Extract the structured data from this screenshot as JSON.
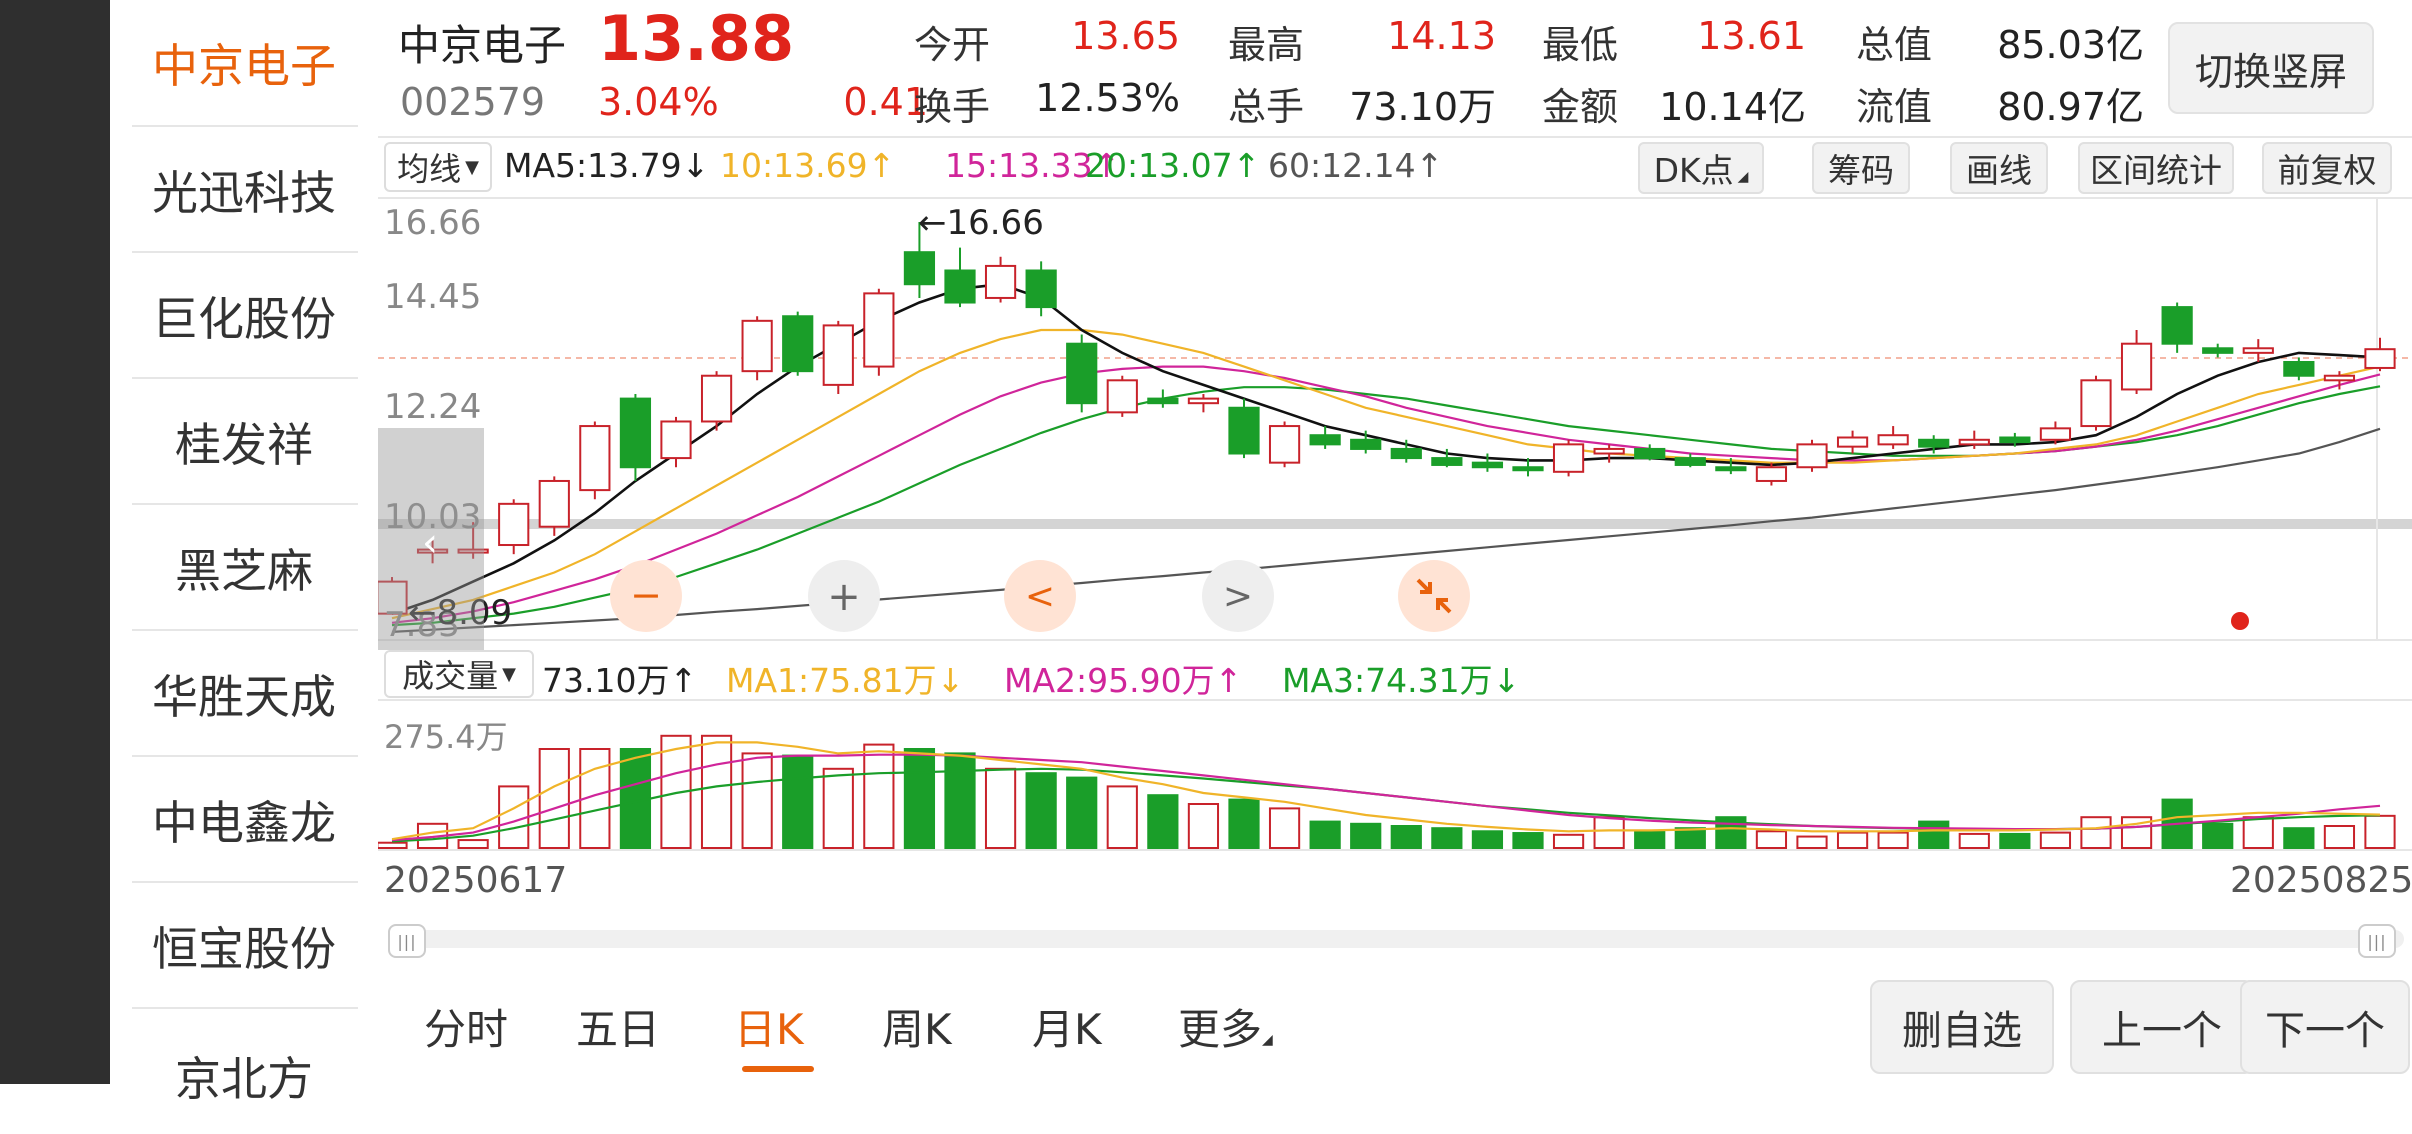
{
  "sidebar": {
    "items": [
      {
        "label": "中京电子",
        "active": true
      },
      {
        "label": "光迅科技",
        "active": false
      },
      {
        "label": "巨化股份",
        "active": false
      },
      {
        "label": "桂发祥",
        "active": false
      },
      {
        "label": "黑芝麻",
        "active": false
      },
      {
        "label": "华胜天成",
        "active": false
      },
      {
        "label": "中电鑫龙",
        "active": false
      },
      {
        "label": "恒宝股份",
        "active": false
      },
      {
        "label": "京北方",
        "active": false
      }
    ]
  },
  "header": {
    "name": "中京电子",
    "price": "13.88",
    "code": "002579",
    "pct_change": "3.04%",
    "change": "0.41",
    "switch_label": "切换竖屏",
    "stats": [
      {
        "label": "今开",
        "value": "13.65",
        "tone": "red"
      },
      {
        "label": "最高",
        "value": "14.13",
        "tone": "red"
      },
      {
        "label": "最低",
        "value": "13.61",
        "tone": "red"
      },
      {
        "label": "总值",
        "value": "85.03亿",
        "tone": "dark"
      },
      {
        "label": "换手",
        "value": "12.53%",
        "tone": "dark"
      },
      {
        "label": "总手",
        "value": "73.10万",
        "tone": "dark"
      },
      {
        "label": "金额",
        "value": "10.14亿",
        "tone": "dark"
      },
      {
        "label": "流值",
        "value": "80.97亿",
        "tone": "dark"
      }
    ]
  },
  "ma_bar": {
    "selector": "均线",
    "ma5": "MA5:13.79↓",
    "ma10": "10:13.69↑",
    "ma15": "15:13.33↑",
    "ma20": "20:13.07↑",
    "ma60": "60:12.14↑",
    "tools": [
      "DK点",
      "筹码",
      "画线",
      "区间统计",
      "前复权"
    ]
  },
  "vol_bar": {
    "selector": "成交量",
    "vol": "73.10万↑",
    "ma1": "MA1:75.81万↓",
    "ma2": "MA2:95.90万↑",
    "ma3": "MA3:74.31万↓"
  },
  "price_axis": [
    "16.66",
    "14.45",
    "12.24",
    "10.03",
    "7.83"
  ],
  "vol_axis": "275.4万",
  "annotations": {
    "high": "←16.66",
    "low": "←8.09"
  },
  "dates": {
    "start": "20250617",
    "end": "20250825"
  },
  "overlay_controls": {
    "back": "‹",
    "zoom_out": "−",
    "zoom_in": "+",
    "prev": "<",
    "next": ">"
  },
  "tabs": [
    {
      "label": "分时",
      "active": false
    },
    {
      "label": "五日",
      "active": false
    },
    {
      "label": "日K",
      "active": true
    },
    {
      "label": "周K",
      "active": false
    },
    {
      "label": "月K",
      "active": false
    },
    {
      "label": "更多",
      "active": false
    }
  ],
  "buttons": {
    "remove": "删自选",
    "prev": "上一个",
    "next": "下一个"
  },
  "colors": {
    "up": "#c8222a",
    "down": "#1a9e29",
    "accent": "#e8620c",
    "ma5": "#111111",
    "ma10": "#f0b429",
    "ma15": "#d0259a",
    "ma20": "#1a9e29",
    "ma60": "#555555"
  },
  "chart_data": {
    "type": "candlestick",
    "date_range": [
      "20250617",
      "20250825"
    ],
    "ylim": [
      7.83,
      16.66
    ],
    "candles": [
      {
        "o": 8.1,
        "h": 8.9,
        "l": 8.09,
        "c": 8.8
      },
      {
        "o": 9.5,
        "h": 9.7,
        "l": 9.2,
        "c": 9.5
      },
      {
        "o": 9.5,
        "h": 10.1,
        "l": 9.3,
        "c": 9.5
      },
      {
        "o": 9.6,
        "h": 10.6,
        "l": 9.4,
        "c": 10.5
      },
      {
        "o": 10.0,
        "h": 11.1,
        "l": 9.8,
        "c": 11.0
      },
      {
        "o": 10.8,
        "h": 12.3,
        "l": 10.6,
        "c": 12.2
      },
      {
        "o": 12.8,
        "h": 12.9,
        "l": 11.0,
        "c": 11.3
      },
      {
        "o": 11.5,
        "h": 12.4,
        "l": 11.3,
        "c": 12.3
      },
      {
        "o": 12.3,
        "h": 13.4,
        "l": 12.1,
        "c": 13.3
      },
      {
        "o": 13.4,
        "h": 14.6,
        "l": 13.2,
        "c": 14.5
      },
      {
        "o": 14.6,
        "h": 14.7,
        "l": 13.3,
        "c": 13.4
      },
      {
        "o": 13.1,
        "h": 14.5,
        "l": 12.9,
        "c": 14.4
      },
      {
        "o": 13.5,
        "h": 15.2,
        "l": 13.3,
        "c": 15.1
      },
      {
        "o": 16.0,
        "h": 16.66,
        "l": 15.0,
        "c": 15.3
      },
      {
        "o": 15.6,
        "h": 16.1,
        "l": 14.8,
        "c": 14.9
      },
      {
        "o": 15.0,
        "h": 15.9,
        "l": 14.9,
        "c": 15.7
      },
      {
        "o": 15.6,
        "h": 15.8,
        "l": 14.6,
        "c": 14.8
      },
      {
        "o": 14.0,
        "h": 14.2,
        "l": 12.5,
        "c": 12.7
      },
      {
        "o": 12.5,
        "h": 13.3,
        "l": 12.4,
        "c": 13.2
      },
      {
        "o": 12.8,
        "h": 13.0,
        "l": 12.6,
        "c": 12.7
      },
      {
        "o": 12.7,
        "h": 12.9,
        "l": 12.5,
        "c": 12.8
      },
      {
        "o": 12.6,
        "h": 12.8,
        "l": 11.5,
        "c": 11.6
      },
      {
        "o": 11.4,
        "h": 12.3,
        "l": 11.3,
        "c": 12.2
      },
      {
        "o": 12.0,
        "h": 12.2,
        "l": 11.7,
        "c": 11.8
      },
      {
        "o": 11.9,
        "h": 12.1,
        "l": 11.6,
        "c": 11.7
      },
      {
        "o": 11.7,
        "h": 11.9,
        "l": 11.4,
        "c": 11.5
      },
      {
        "o": 11.5,
        "h": 11.7,
        "l": 11.3,
        "c": 11.35
      },
      {
        "o": 11.4,
        "h": 11.6,
        "l": 11.2,
        "c": 11.3
      },
      {
        "o": 11.3,
        "h": 11.5,
        "l": 11.1,
        "c": 11.25
      },
      {
        "o": 11.2,
        "h": 11.9,
        "l": 11.1,
        "c": 11.8
      },
      {
        "o": 11.6,
        "h": 11.8,
        "l": 11.4,
        "c": 11.7
      },
      {
        "o": 11.7,
        "h": 11.8,
        "l": 11.45,
        "c": 11.5
      },
      {
        "o": 11.5,
        "h": 11.6,
        "l": 11.3,
        "c": 11.35
      },
      {
        "o": 11.3,
        "h": 11.5,
        "l": 11.15,
        "c": 11.25
      },
      {
        "o": 11.0,
        "h": 11.4,
        "l": 10.9,
        "c": 11.3
      },
      {
        "o": 11.3,
        "h": 11.9,
        "l": 11.2,
        "c": 11.8
      },
      {
        "o": 11.75,
        "h": 12.1,
        "l": 11.6,
        "c": 11.95
      },
      {
        "o": 11.8,
        "h": 12.2,
        "l": 11.7,
        "c": 12.0
      },
      {
        "o": 11.9,
        "h": 12.0,
        "l": 11.6,
        "c": 11.75
      },
      {
        "o": 11.8,
        "h": 12.1,
        "l": 11.7,
        "c": 11.9
      },
      {
        "o": 11.95,
        "h": 12.05,
        "l": 11.75,
        "c": 11.85
      },
      {
        "o": 11.9,
        "h": 12.3,
        "l": 11.8,
        "c": 12.15
      },
      {
        "o": 12.2,
        "h": 13.3,
        "l": 12.1,
        "c": 13.2
      },
      {
        "o": 13.0,
        "h": 14.3,
        "l": 12.9,
        "c": 14.0
      },
      {
        "o": 14.8,
        "h": 14.9,
        "l": 13.8,
        "c": 14.0
      },
      {
        "o": 13.9,
        "h": 14.0,
        "l": 13.7,
        "c": 13.8
      },
      {
        "o": 13.8,
        "h": 14.1,
        "l": 13.6,
        "c": 13.9
      },
      {
        "o": 13.6,
        "h": 13.7,
        "l": 13.2,
        "c": 13.3
      },
      {
        "o": 13.2,
        "h": 13.4,
        "l": 13.0,
        "c": 13.3
      },
      {
        "o": 13.47,
        "h": 14.13,
        "l": 13.4,
        "c": 13.88
      }
    ],
    "ma": {
      "ma5": [
        8.1,
        8.4,
        8.8,
        9.2,
        9.7,
        10.3,
        11.0,
        11.6,
        12.2,
        12.9,
        13.5,
        14.0,
        14.5,
        14.9,
        15.2,
        15.3,
        15.0,
        14.3,
        13.8,
        13.4,
        13.1,
        12.8,
        12.5,
        12.2,
        12.0,
        11.8,
        11.6,
        11.5,
        11.45,
        11.45,
        11.5,
        11.5,
        11.45,
        11.4,
        11.35,
        11.4,
        11.5,
        11.6,
        11.7,
        11.8,
        11.8,
        11.85,
        12.0,
        12.4,
        12.9,
        13.3,
        13.6,
        13.8,
        13.75,
        13.7
      ],
      "ma10": [
        8.0,
        8.2,
        8.4,
        8.7,
        9.0,
        9.4,
        9.9,
        10.4,
        10.9,
        11.4,
        11.9,
        12.4,
        12.9,
        13.4,
        13.8,
        14.1,
        14.3,
        14.3,
        14.2,
        14.0,
        13.8,
        13.5,
        13.2,
        12.9,
        12.6,
        12.4,
        12.2,
        12.0,
        11.8,
        11.7,
        11.6,
        11.55,
        11.5,
        11.45,
        11.4,
        11.4,
        11.4,
        11.45,
        11.5,
        11.55,
        11.6,
        11.7,
        11.8,
        12.0,
        12.3,
        12.6,
        12.9,
        13.1,
        13.3,
        13.5
      ],
      "ma15": [
        7.9,
        8.0,
        8.15,
        8.35,
        8.6,
        8.85,
        9.15,
        9.5,
        9.85,
        10.25,
        10.65,
        11.1,
        11.55,
        12.0,
        12.45,
        12.85,
        13.15,
        13.35,
        13.45,
        13.5,
        13.5,
        13.4,
        13.25,
        13.05,
        12.85,
        12.6,
        12.4,
        12.2,
        12.05,
        11.9,
        11.8,
        11.7,
        11.6,
        11.55,
        11.5,
        11.45,
        11.45,
        11.45,
        11.5,
        11.55,
        11.6,
        11.65,
        11.75,
        11.9,
        12.1,
        12.35,
        12.6,
        12.85,
        13.1,
        13.33
      ],
      "ma20": [
        7.85,
        7.9,
        8.0,
        8.1,
        8.25,
        8.45,
        8.65,
        8.9,
        9.2,
        9.5,
        9.85,
        10.2,
        10.55,
        10.95,
        11.35,
        11.7,
        12.05,
        12.35,
        12.6,
        12.8,
        12.95,
        13.05,
        13.05,
        13.0,
        12.9,
        12.8,
        12.65,
        12.5,
        12.35,
        12.2,
        12.1,
        12.0,
        11.9,
        11.8,
        11.7,
        11.65,
        11.6,
        11.55,
        11.55,
        11.55,
        11.6,
        11.65,
        11.75,
        11.85,
        12.0,
        12.2,
        12.45,
        12.7,
        12.9,
        13.07
      ],
      "ma60": [
        7.7,
        7.75,
        7.8,
        7.85,
        7.9,
        7.95,
        8.0,
        8.07,
        8.14,
        8.2,
        8.27,
        8.34,
        8.41,
        8.48,
        8.55,
        8.62,
        8.7,
        8.77,
        8.85,
        8.92,
        9.0,
        9.07,
        9.15,
        9.23,
        9.31,
        9.39,
        9.47,
        9.55,
        9.63,
        9.71,
        9.79,
        9.87,
        9.95,
        10.03,
        10.12,
        10.2,
        10.3,
        10.4,
        10.5,
        10.6,
        10.7,
        10.8,
        10.92,
        11.04,
        11.17,
        11.3,
        11.45,
        11.6,
        11.85,
        12.14
      ]
    },
    "volume_wan": [
      12,
      55,
      18,
      140,
      225,
      225,
      225,
      255,
      255,
      215,
      210,
      180,
      235,
      225,
      215,
      180,
      170,
      160,
      140,
      120,
      100,
      110,
      90,
      60,
      55,
      50,
      45,
      38,
      34,
      30,
      70,
      38,
      45,
      70,
      38,
      26,
      35,
      35,
      60,
      32,
      32,
      35,
      70,
      70,
      110,
      55,
      70,
      45,
      50,
      73.1
    ],
    "volume_ma": {
      "ma1": [
        20,
        35,
        45,
        90,
        140,
        180,
        205,
        225,
        240,
        240,
        230,
        215,
        220,
        215,
        210,
        200,
        190,
        180,
        160,
        145,
        125,
        115,
        105,
        90,
        75,
        65,
        55,
        48,
        42,
        38,
        40,
        40,
        42,
        45,
        42,
        38,
        38,
        38,
        40,
        40,
        40,
        42,
        45,
        55,
        70,
        75,
        80,
        80,
        78,
        75.81
      ],
      "ma2": [
        18,
        25,
        35,
        60,
        90,
        120,
        145,
        170,
        190,
        205,
        210,
        210,
        212,
        212,
        210,
        205,
        200,
        195,
        185,
        175,
        165,
        155,
        145,
        135,
        125,
        115,
        105,
        95,
        85,
        75,
        68,
        62,
        58,
        55,
        52,
        50,
        48,
        46,
        45,
        44,
        43,
        43,
        44,
        48,
        55,
        62,
        70,
        78,
        88,
        95.9
      ],
      "ma3": [
        15,
        20,
        28,
        45,
        65,
        85,
        105,
        125,
        140,
        150,
        158,
        165,
        170,
        172,
        175,
        178,
        180,
        178,
        172,
        165,
        158,
        150,
        142,
        135,
        125,
        115,
        105,
        95,
        88,
        80,
        74,
        68,
        63,
        58,
        54,
        50,
        47,
        45,
        44,
        43,
        42,
        43,
        44,
        48,
        54,
        60,
        66,
        70,
        73,
        74.31
      ]
    },
    "volume_ylim": [
      0,
      300
    ]
  }
}
